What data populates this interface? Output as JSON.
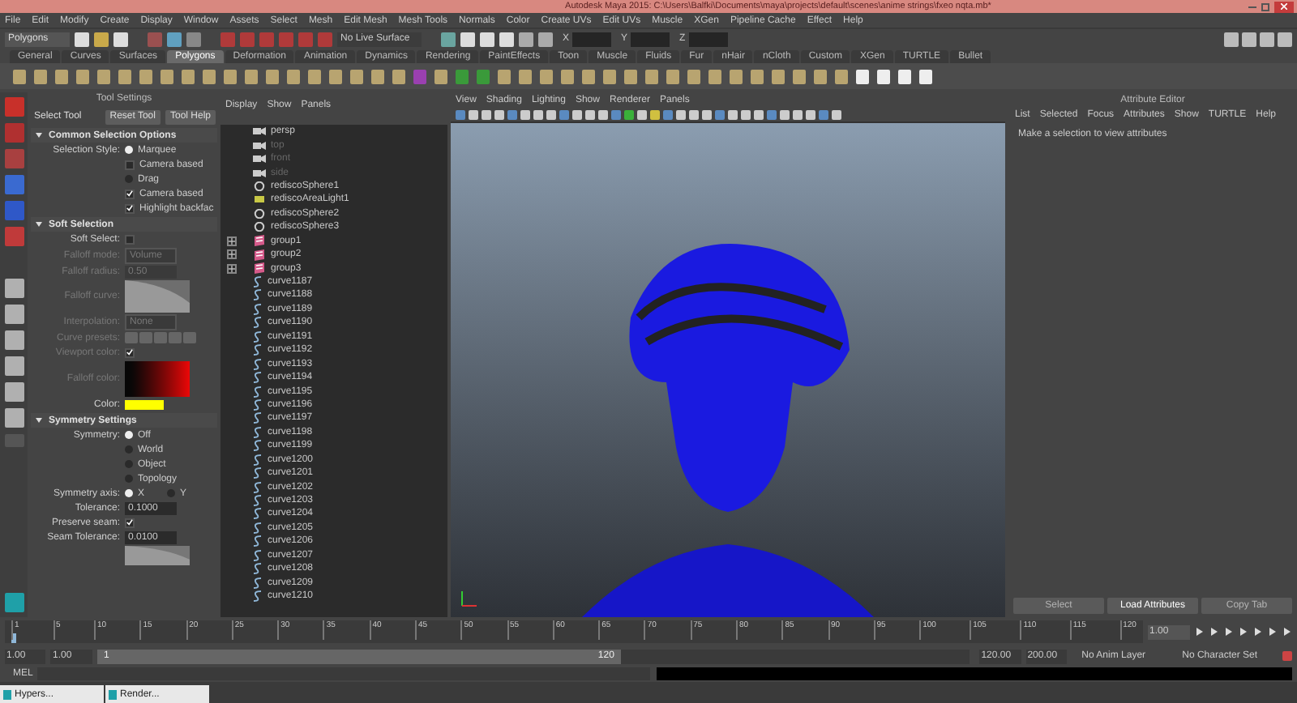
{
  "window": {
    "title": "Autodesk Maya 2015: C:\\Users\\Balfki\\Documents\\maya\\projects\\default\\scenes\\anime strings\\fxeo nqta.mb*"
  },
  "menu_bar": [
    "File",
    "Edit",
    "Modify",
    "Create",
    "Display",
    "Window",
    "Assets",
    "Select",
    "Mesh",
    "Edit Mesh",
    "Mesh Tools",
    "Normals",
    "Color",
    "Create UVs",
    "Edit UVs",
    "Muscle",
    "XGen",
    "Pipeline Cache",
    "Effect",
    "Help"
  ],
  "status_line": {
    "menu_set": "Polygons",
    "live_surface": "No Live Surface",
    "fields": [
      "X",
      "Y",
      "Z"
    ]
  },
  "shelf_tabs": [
    {
      "label": "General",
      "selected": false
    },
    {
      "label": "Curves",
      "selected": false
    },
    {
      "label": "Surfaces",
      "selected": false
    },
    {
      "label": "Polygons",
      "selected": true
    },
    {
      "label": "Deformation",
      "selected": false
    },
    {
      "label": "Animation",
      "selected": false
    },
    {
      "label": "Dynamics",
      "selected": false
    },
    {
      "label": "Rendering",
      "selected": false
    },
    {
      "label": "PaintEffects",
      "selected": false
    },
    {
      "label": "Toon",
      "selected": false
    },
    {
      "label": "Muscle",
      "selected": false
    },
    {
      "label": "Fluids",
      "selected": false
    },
    {
      "label": "Fur",
      "selected": false
    },
    {
      "label": "nHair",
      "selected": false
    },
    {
      "label": "nCloth",
      "selected": false
    },
    {
      "label": "Custom",
      "selected": false
    },
    {
      "label": "XGen",
      "selected": false
    },
    {
      "label": "TURTLE",
      "selected": false
    },
    {
      "label": "Bullet",
      "selected": false
    }
  ],
  "tool_settings": {
    "title": "Tool Settings",
    "tool": "Select Tool",
    "buttons": [
      "Reset Tool",
      "Tool Help"
    ],
    "sections": [
      {
        "title": "Common Selection Options",
        "expanded": true,
        "rows": [
          {
            "kind": "radio",
            "label": "Selection Style:",
            "text": "Marquee",
            "selected": true
          },
          {
            "kind": "check",
            "text": "Camera based",
            "checked": false
          },
          {
            "kind": "radio",
            "text": "Drag",
            "selected": false
          },
          {
            "kind": "check",
            "text": "Camera based",
            "checked": true
          },
          {
            "kind": "check",
            "text": "Highlight backfac",
            "checked": true
          }
        ]
      },
      {
        "title": "Soft Selection",
        "expanded": true,
        "rows": [
          {
            "kind": "check",
            "label": "Soft Select:",
            "checked": false
          },
          {
            "kind": "dropdown",
            "label": "Falloff mode:",
            "value": "Volume",
            "disabled": true
          },
          {
            "kind": "field",
            "label": "Falloff radius:",
            "value": "0.50",
            "disabled": true
          },
          {
            "kind": "curve",
            "label": "Falloff curve:",
            "disabled": true
          },
          {
            "kind": "dropdown",
            "label": "Interpolation:",
            "value": "None",
            "disabled": true
          },
          {
            "kind": "presets",
            "label": "Curve presets:",
            "disabled": true
          },
          {
            "kind": "check",
            "label": "Viewport color:",
            "checked": true,
            "disabled": true
          },
          {
            "kind": "gradient",
            "label": "Falloff color:",
            "disabled": true
          },
          {
            "kind": "swatch",
            "label": "Color:",
            "color": "#ffff00"
          }
        ]
      },
      {
        "title": "Symmetry Settings",
        "expanded": true,
        "rows": [
          {
            "kind": "radio",
            "label": "Symmetry:",
            "text": "Off",
            "selected": true
          },
          {
            "kind": "radio",
            "text": "World",
            "selected": false
          },
          {
            "kind": "radio",
            "text": "Object",
            "selected": false
          },
          {
            "kind": "radio",
            "text": "Topology",
            "selected": false
          },
          {
            "kind": "axis",
            "label": "Symmetry axis:",
            "options": [
              {
                "text": "X",
                "selected": true
              },
              {
                "text": "Y",
                "selected": false
              }
            ]
          },
          {
            "kind": "field",
            "label": "Tolerance:",
            "value": "0.1000"
          },
          {
            "kind": "check",
            "label": "Preserve seam:",
            "checked": true
          },
          {
            "kind": "field",
            "label": "Seam Tolerance:",
            "value": "0.0100"
          },
          {
            "kind": "curve"
          }
        ]
      }
    ]
  },
  "outliner": {
    "menu": [
      "Display",
      "Show",
      "Panels"
    ],
    "items": [
      {
        "kind": "camera",
        "label": "persp",
        "dimmed": false
      },
      {
        "kind": "camera",
        "label": "top",
        "dimmed": true
      },
      {
        "kind": "camera",
        "label": "front",
        "dimmed": true
      },
      {
        "kind": "camera",
        "label": "side",
        "dimmed": true
      },
      {
        "kind": "sphere",
        "label": "rediscoSphere1",
        "dimmed": false
      },
      {
        "kind": "light",
        "label": "rediscoAreaLight1",
        "dimmed": false
      },
      {
        "kind": "sphere",
        "label": "rediscoSphere2",
        "dimmed": false
      },
      {
        "kind": "sphere",
        "label": "rediscoSphere3",
        "dimmed": false
      },
      {
        "kind": "group",
        "label": "group1",
        "expanded": false
      },
      {
        "kind": "group",
        "label": "group2",
        "expanded": false
      },
      {
        "kind": "group",
        "label": "group3",
        "expanded": false
      },
      {
        "kind": "curve",
        "label": "curve1187"
      },
      {
        "kind": "curve",
        "label": "curve1188"
      },
      {
        "kind": "curve",
        "label": "curve1189"
      },
      {
        "kind": "curve",
        "label": "curve1190"
      },
      {
        "kind": "curve",
        "label": "curve1191"
      },
      {
        "kind": "curve",
        "label": "curve1192"
      },
      {
        "kind": "curve",
        "label": "curve1193"
      },
      {
        "kind": "curve",
        "label": "curve1194"
      },
      {
        "kind": "curve",
        "label": "curve1195"
      },
      {
        "kind": "curve",
        "label": "curve1196"
      },
      {
        "kind": "curve",
        "label": "curve1197"
      },
      {
        "kind": "curve",
        "label": "curve1198"
      },
      {
        "kind": "curve",
        "label": "curve1199"
      },
      {
        "kind": "curve",
        "label": "curve1200"
      },
      {
        "kind": "curve",
        "label": "curve1201"
      },
      {
        "kind": "curve",
        "label": "curve1202"
      },
      {
        "kind": "curve",
        "label": "curve1203"
      },
      {
        "kind": "curve",
        "label": "curve1204"
      },
      {
        "kind": "curve",
        "label": "curve1205"
      },
      {
        "kind": "curve",
        "label": "curve1206"
      },
      {
        "kind": "curve",
        "label": "curve1207"
      },
      {
        "kind": "curve",
        "label": "curve1208"
      },
      {
        "kind": "curve",
        "label": "curve1209"
      },
      {
        "kind": "curve",
        "label": "curve1210"
      }
    ]
  },
  "viewport": {
    "menu": [
      "View",
      "Shading",
      "Lighting",
      "Show",
      "Renderer",
      "Panels"
    ]
  },
  "attribute_editor": {
    "title": "Attribute Editor",
    "menu": [
      "List",
      "Selected",
      "Focus",
      "Attributes",
      "Show",
      "TURTLE",
      "Help"
    ],
    "message": "Make a selection to view attributes",
    "buttons": [
      {
        "label": "Select",
        "disabled": true
      },
      {
        "label": "Load Attributes",
        "disabled": false
      },
      {
        "label": "Copy Tab",
        "disabled": true
      }
    ]
  },
  "timeline": {
    "ticks": [
      "1",
      "5",
      "10",
      "15",
      "20",
      "25",
      "30",
      "35",
      "40",
      "45",
      "50",
      "55",
      "60",
      "65",
      "70",
      "75",
      "80",
      "85",
      "90",
      "95",
      "100",
      "105",
      "110",
      "115",
      "120"
    ],
    "current_frame": "1.00",
    "level": 0
  },
  "range": {
    "start": "1.00",
    "playback_start": "1.00",
    "slider_start": "1",
    "slider_end": "120",
    "level": 0.6,
    "playback_end": "120.00",
    "end": "200.00",
    "anim_layer": "No Anim Layer",
    "character_set": "No Character Set"
  },
  "command_line": {
    "label": "MEL"
  },
  "taskbar": [
    "Hypers...",
    "Render..."
  ]
}
